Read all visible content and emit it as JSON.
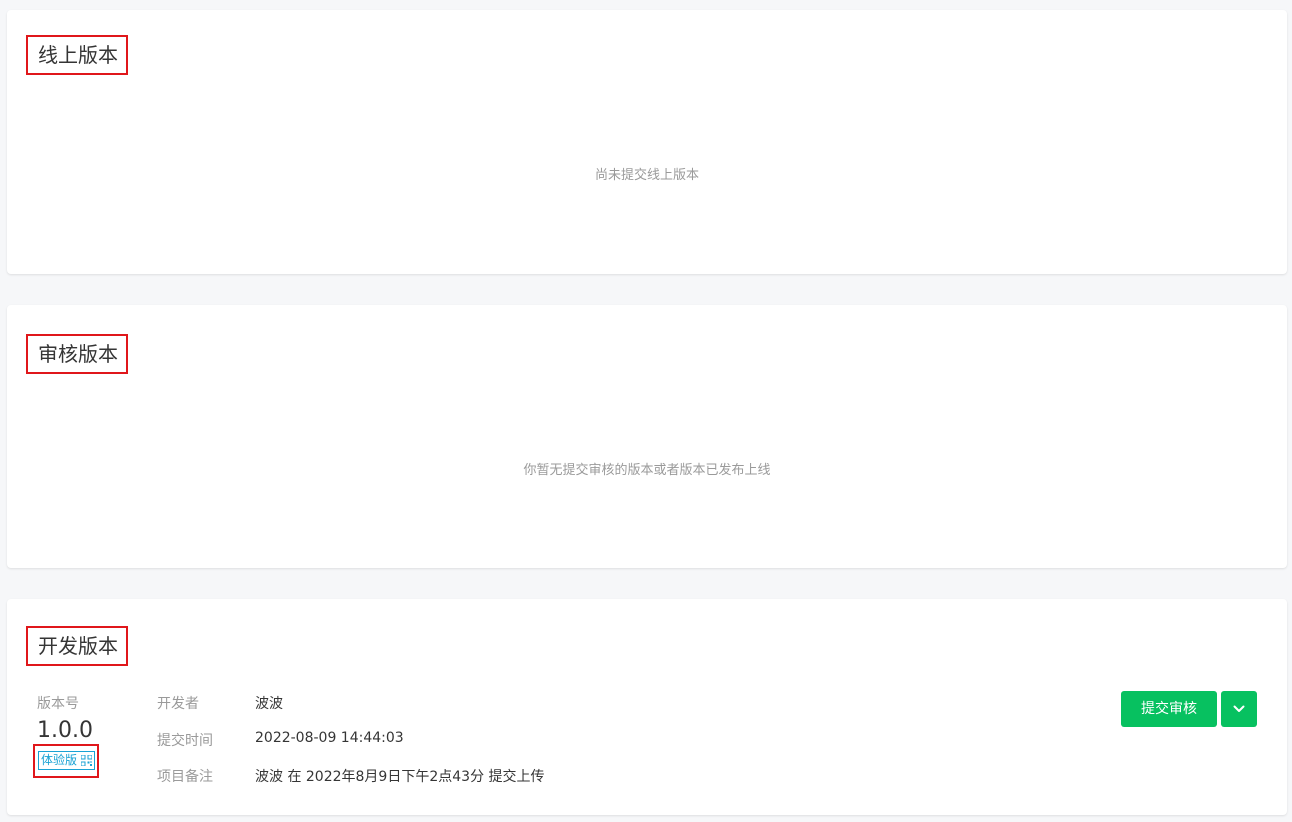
{
  "online": {
    "title": "线上版本",
    "empty_text": "尚未提交线上版本"
  },
  "review": {
    "title": "审核版本",
    "empty_text": "你暂无提交审核的版本或者版本已发布上线"
  },
  "dev": {
    "title": "开发版本",
    "version_label": "版本号",
    "version_number": "1.0.0",
    "tag_label": "体验版",
    "tag_icon": "qrcode-icon",
    "developer_label": "开发者",
    "developer_value": "波波",
    "submit_time_label": "提交时间",
    "submit_time_value": "2022-08-09 14:44:03",
    "remark_label": "项目备注",
    "remark_value": "波波 在 2022年8月9日下午2点43分 提交上传",
    "submit_button": "提交审核",
    "dropdown_icon": "chevron-down-icon"
  },
  "colors": {
    "primary_green": "#07c160",
    "tag_blue": "#1aa2d4",
    "highlight_red": "#e0171b",
    "page_bg": "#f6f7f9"
  }
}
